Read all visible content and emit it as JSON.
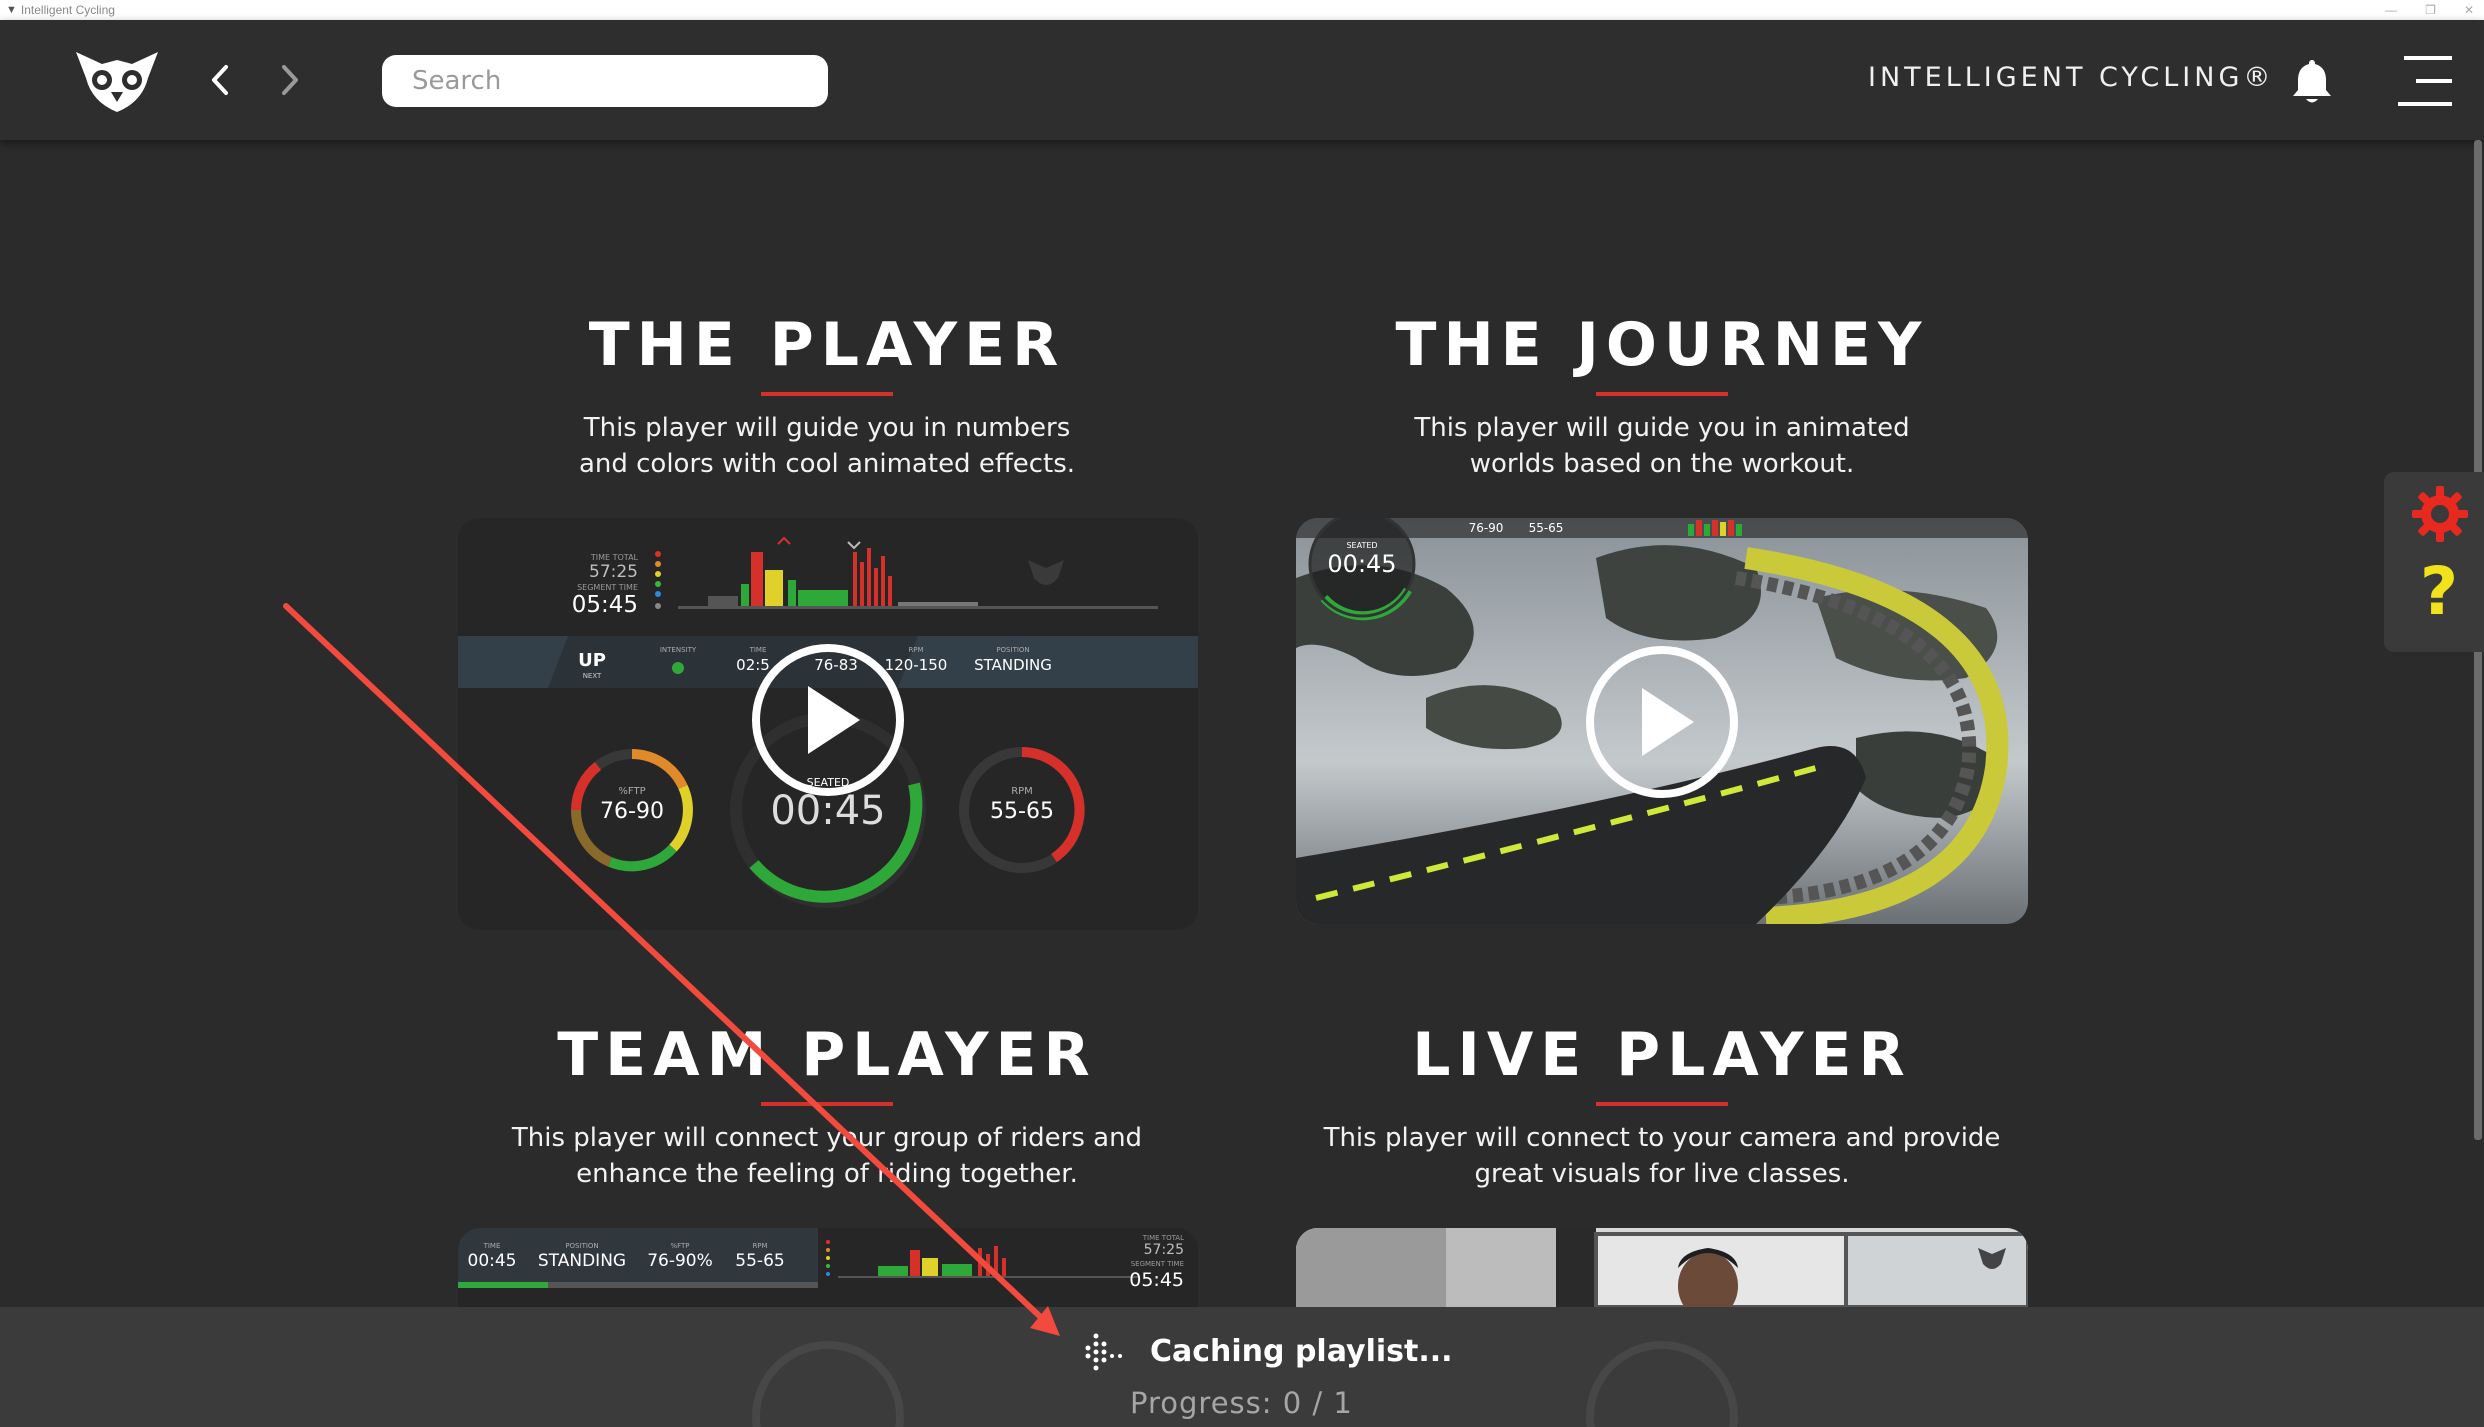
{
  "window": {
    "title": "Intelligent Cycling"
  },
  "header": {
    "search_placeholder": "Search",
    "brand": "INTELLIGENT CYCLING®"
  },
  "colors": {
    "accent": "#d6302a",
    "help": "#f2e21b",
    "gear": "#e8291f",
    "background": "#2b2b2b"
  },
  "cards": [
    {
      "title": "THE PLAYER",
      "description_line1": "This player will guide you in numbers",
      "description_line2": "and colors with cool animated effects.",
      "thumb": {
        "time_total_label": "TIME TOTAL",
        "time_total": "57:25",
        "segment_time_label": "SEGMENT TIME",
        "segment_time": "05:45",
        "up_label": "UP",
        "next_label": "NEXT",
        "intensity_label": "INTENSITY",
        "time_label": "TIME",
        "time_value": "02:5",
        "range_value": "76-83",
        "rpm_label": "RPM",
        "rpm_value": "120-150",
        "position_label": "POSITION",
        "position_value": "STANDING",
        "ftp_label": "%FTP",
        "ftp_value": "76-90",
        "seated_label": "SEATED",
        "main_time": "00:45",
        "rpm2_label": "RPM",
        "rpm2_value": "55-65"
      }
    },
    {
      "title": "THE JOURNEY",
      "description_line1": "This player will guide you in animated",
      "description_line2": "worlds based on the workout.",
      "thumb": {
        "seated_label": "SEATED",
        "time": "00:45",
        "range1": "76-90",
        "range2": "55-65"
      }
    },
    {
      "title": "TEAM PLAYER",
      "description_line1": "This player will connect your group of riders and",
      "description_line2": "enhance the feeling of riding together.",
      "thumb": {
        "time_label": "TIME",
        "time": "00:45",
        "position_label": "POSITION",
        "position": "STANDING",
        "ftp_label": "%FTP",
        "ftp": "76-90%",
        "rpm_label": "RPM",
        "rpm": "55-65",
        "time_total_label": "TIME TOTAL",
        "time_total": "57:25",
        "segment_time_label": "SEGMENT TIME",
        "segment_time": "05:45"
      }
    },
    {
      "title": "LIVE PLAYER",
      "description_line1": "This player will connect to your camera and provide",
      "description_line2": "great visuals for live classes.",
      "thumb": {}
    }
  ],
  "status": {
    "caching_text": "Caching playlist...",
    "progress_text": "Progress: 0 / 1"
  }
}
